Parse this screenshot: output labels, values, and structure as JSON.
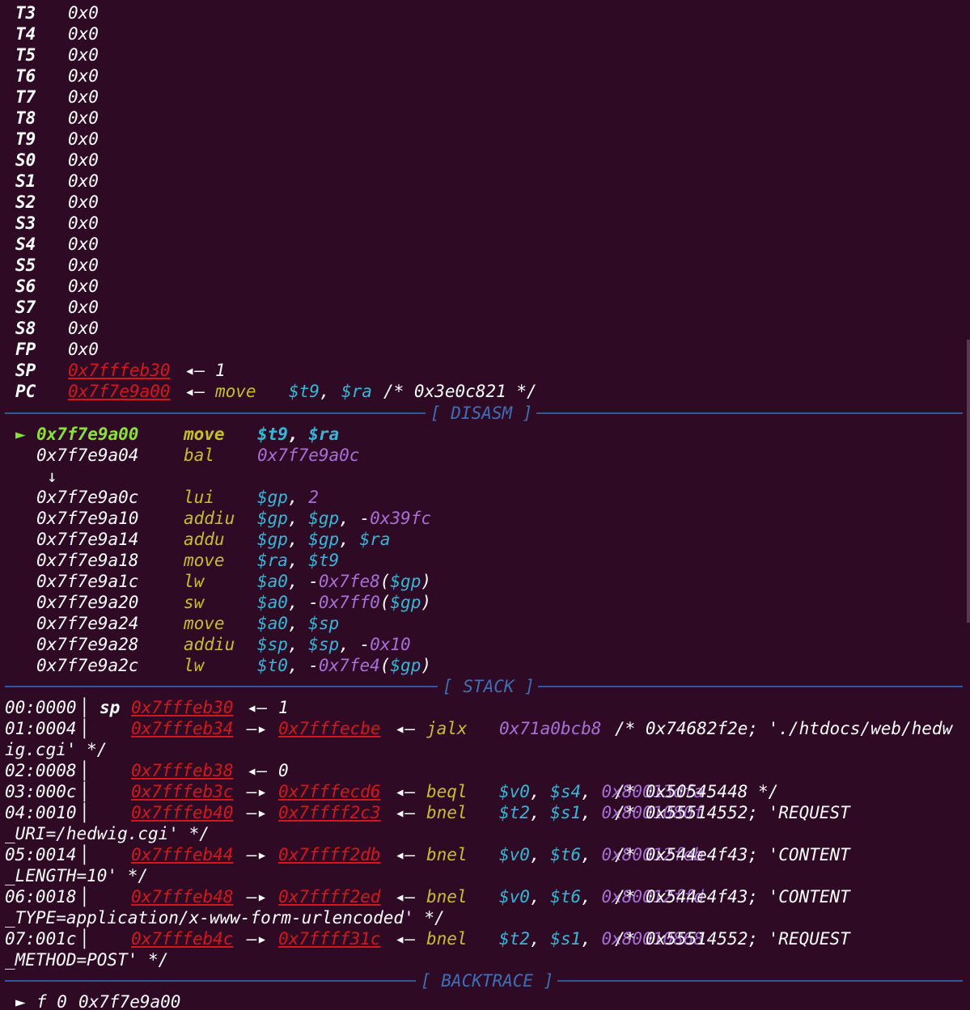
{
  "registers": [
    {
      "name": "T3",
      "value": "0x0"
    },
    {
      "name": "T4",
      "value": "0x0"
    },
    {
      "name": "T5",
      "value": "0x0"
    },
    {
      "name": "T6",
      "value": "0x0"
    },
    {
      "name": "T7",
      "value": "0x0"
    },
    {
      "name": "T8",
      "value": "0x0"
    },
    {
      "name": "T9",
      "value": "0x0"
    },
    {
      "name": "S0",
      "value": "0x0"
    },
    {
      "name": "S1",
      "value": "0x0"
    },
    {
      "name": "S2",
      "value": "0x0"
    },
    {
      "name": "S3",
      "value": "0x0"
    },
    {
      "name": "S4",
      "value": "0x0"
    },
    {
      "name": "S5",
      "value": "0x0"
    },
    {
      "name": "S6",
      "value": "0x0"
    },
    {
      "name": "S7",
      "value": "0x0"
    },
    {
      "name": "S8",
      "value": "0x0"
    },
    {
      "name": "FP",
      "value": "0x0"
    }
  ],
  "sp_reg": {
    "name": "SP",
    "addr": "0x7fffeb30",
    "arrow": "◂—",
    "value": "1"
  },
  "pc_reg": {
    "name": "PC",
    "addr": "0x7f7e9a00",
    "arrow": "◂—",
    "mnemonic": "move",
    "op1": "$t9",
    "comma": ",",
    "op2": "$ra",
    "comment": "/* 0x3e0c821 */"
  },
  "headers": {
    "disasm": "[ DISASM ]",
    "stack": "[ STACK ]",
    "backtrace": "[ BACKTRACE ]"
  },
  "disasm": {
    "current_marker": "►",
    "jump_marker": "↓",
    "lines": [
      {
        "addr": "0x7f7e9a00",
        "mn": "move",
        "ops": [
          {
            "t": "$t9",
            "c": "cyan"
          },
          {
            "t": ", ",
            "c": "white"
          },
          {
            "t": "$ra",
            "c": "cyan"
          }
        ]
      },
      {
        "addr": "0x7f7e9a04",
        "mn": "bal",
        "ops": [
          {
            "t": "0x7f7e9a0c",
            "c": "purple"
          }
        ]
      },
      {
        "addr": "0x7f7e9a0c",
        "mn": "lui",
        "ops": [
          {
            "t": "$gp",
            "c": "cyan"
          },
          {
            "t": ", ",
            "c": "white"
          },
          {
            "t": "2",
            "c": "purple"
          }
        ]
      },
      {
        "addr": "0x7f7e9a10",
        "mn": "addiu",
        "ops": [
          {
            "t": "$gp",
            "c": "cyan"
          },
          {
            "t": ", ",
            "c": "white"
          },
          {
            "t": "$gp",
            "c": "cyan"
          },
          {
            "t": ", ",
            "c": "white"
          },
          {
            "t": "-",
            "c": "white"
          },
          {
            "t": "0x39fc",
            "c": "purple"
          }
        ]
      },
      {
        "addr": "0x7f7e9a14",
        "mn": "addu",
        "ops": [
          {
            "t": "$gp",
            "c": "cyan"
          },
          {
            "t": ", ",
            "c": "white"
          },
          {
            "t": "$gp",
            "c": "cyan"
          },
          {
            "t": ", ",
            "c": "white"
          },
          {
            "t": "$ra",
            "c": "cyan"
          }
        ]
      },
      {
        "addr": "0x7f7e9a18",
        "mn": "move",
        "ops": [
          {
            "t": "$ra",
            "c": "cyan"
          },
          {
            "t": ", ",
            "c": "white"
          },
          {
            "t": "$t9",
            "c": "cyan"
          }
        ]
      },
      {
        "addr": "0x7f7e9a1c",
        "mn": "lw",
        "ops": [
          {
            "t": "$a0",
            "c": "cyan"
          },
          {
            "t": ", ",
            "c": "white"
          },
          {
            "t": "-",
            "c": "white"
          },
          {
            "t": "0x7fe8",
            "c": "purple"
          },
          {
            "t": "(",
            "c": "white"
          },
          {
            "t": "$gp",
            "c": "cyan"
          },
          {
            "t": ")",
            "c": "white"
          }
        ]
      },
      {
        "addr": "0x7f7e9a20",
        "mn": "sw",
        "ops": [
          {
            "t": "$a0",
            "c": "cyan"
          },
          {
            "t": ", ",
            "c": "white"
          },
          {
            "t": "-",
            "c": "white"
          },
          {
            "t": "0x7ff0",
            "c": "purple"
          },
          {
            "t": "(",
            "c": "white"
          },
          {
            "t": "$gp",
            "c": "cyan"
          },
          {
            "t": ")",
            "c": "white"
          }
        ]
      },
      {
        "addr": "0x7f7e9a24",
        "mn": "move",
        "ops": [
          {
            "t": "$a0",
            "c": "cyan"
          },
          {
            "t": ", ",
            "c": "white"
          },
          {
            "t": "$sp",
            "c": "cyan"
          }
        ]
      },
      {
        "addr": "0x7f7e9a28",
        "mn": "addiu",
        "ops": [
          {
            "t": "$sp",
            "c": "cyan"
          },
          {
            "t": ", ",
            "c": "white"
          },
          {
            "t": "$sp",
            "c": "cyan"
          },
          {
            "t": ", ",
            "c": "white"
          },
          {
            "t": "-",
            "c": "white"
          },
          {
            "t": "0x10",
            "c": "purple"
          }
        ]
      },
      {
        "addr": "0x7f7e9a2c",
        "mn": "lw",
        "ops": [
          {
            "t": "$t0",
            "c": "cyan"
          },
          {
            "t": ", ",
            "c": "white"
          },
          {
            "t": "-",
            "c": "white"
          },
          {
            "t": "0x7fe4",
            "c": "purple"
          },
          {
            "t": "(",
            "c": "white"
          },
          {
            "t": "$gp",
            "c": "cyan"
          },
          {
            "t": ")",
            "c": "white"
          }
        ]
      }
    ]
  },
  "stack": {
    "sp_label": "sp",
    "lines": [
      {
        "index": "00:0000",
        "addr": "0x7fffeb30",
        "arrow": "◂—",
        "value": "1"
      },
      {
        "index": "01:0004",
        "addr": "0x7fffeb34",
        "arrow": "—▸",
        "ptr": "0x7fffecbe",
        "arrow2": "◂—",
        "mn": "jalx",
        "ops": [
          {
            "t": "0x71a0bcb8",
            "c": "purple"
          }
        ],
        "comment": "/* 0x74682f2e; './htdocs/web/hedw",
        "wrap": "ig.cgi' */"
      },
      {
        "index": "02:0008",
        "addr": "0x7fffeb38",
        "arrow": "◂—",
        "value": "0"
      },
      {
        "index": "03:000c",
        "addr": "0x7fffeb3c",
        "arrow": "—▸",
        "ptr": "0x7fffecd6",
        "arrow2": "◂—",
        "mn": "beql",
        "ops": [
          {
            "t": "$v0",
            "c": "cyan"
          },
          {
            "t": ", ",
            "c": "white"
          },
          {
            "t": "$s4",
            "c": "cyan"
          },
          {
            "t": ", ",
            "c": "white"
          },
          {
            "t": "0x80013dfa",
            "c": "purple"
          }
        ],
        "comment": "/* 0x50545448 */"
      },
      {
        "index": "04:0010",
        "addr": "0x7fffeb40",
        "arrow": "—▸",
        "ptr": "0x7ffff2c3",
        "arrow2": "◂—",
        "mn": "bnel",
        "ops": [
          {
            "t": "$t2",
            "c": "cyan"
          },
          {
            "t": ", ",
            "c": "white"
          },
          {
            "t": "$s1",
            "c": "cyan"
          },
          {
            "t": ", ",
            "c": "white"
          },
          {
            "t": "0x8001080f",
            "c": "purple"
          }
        ],
        "comment": "/* 0x55514552; 'REQUEST",
        "wrap": "_URI=/hedwig.cgi' */"
      },
      {
        "index": "05:0014",
        "addr": "0x7fffeb44",
        "arrow": "—▸",
        "ptr": "0x7ffff2db",
        "arrow2": "◂—",
        "mn": "bnel",
        "ops": [
          {
            "t": "$v0",
            "c": "cyan"
          },
          {
            "t": ", ",
            "c": "white"
          },
          {
            "t": "$t6",
            "c": "cyan"
          },
          {
            "t": ", ",
            "c": "white"
          },
          {
            "t": "0x80012feb",
            "c": "purple"
          }
        ],
        "comment": "/* 0x544e4f43; 'CONTENT",
        "wrap": "_LENGTH=10' */"
      },
      {
        "index": "06:0018",
        "addr": "0x7fffeb48",
        "arrow": "—▸",
        "ptr": "0x7ffff2ed",
        "arrow2": "◂—",
        "mn": "bnel",
        "ops": [
          {
            "t": "$v0",
            "c": "cyan"
          },
          {
            "t": ", ",
            "c": "white"
          },
          {
            "t": "$t6",
            "c": "cyan"
          },
          {
            "t": ", ",
            "c": "white"
          },
          {
            "t": "0x80012ffd",
            "c": "purple"
          }
        ],
        "comment": "/* 0x544e4f43; 'CONTENT",
        "wrap": "_TYPE=application/x-www-form-urlencoded' */"
      },
      {
        "index": "07:001c",
        "addr": "0x7fffeb4c",
        "arrow": "—▸",
        "ptr": "0x7ffff31c",
        "arrow2": "◂—",
        "mn": "bnel",
        "ops": [
          {
            "t": "$t2",
            "c": "cyan"
          },
          {
            "t": ", ",
            "c": "white"
          },
          {
            "t": "$s1",
            "c": "cyan"
          },
          {
            "t": ", ",
            "c": "white"
          },
          {
            "t": "0x80010868",
            "c": "purple"
          }
        ],
        "comment": "/* 0x55514552; 'REQUEST",
        "wrap": "_METHOD=POST' */"
      }
    ]
  },
  "backtrace": {
    "marker": "►",
    "frame": "f 0",
    "addr": "0x7f7e9a00"
  }
}
